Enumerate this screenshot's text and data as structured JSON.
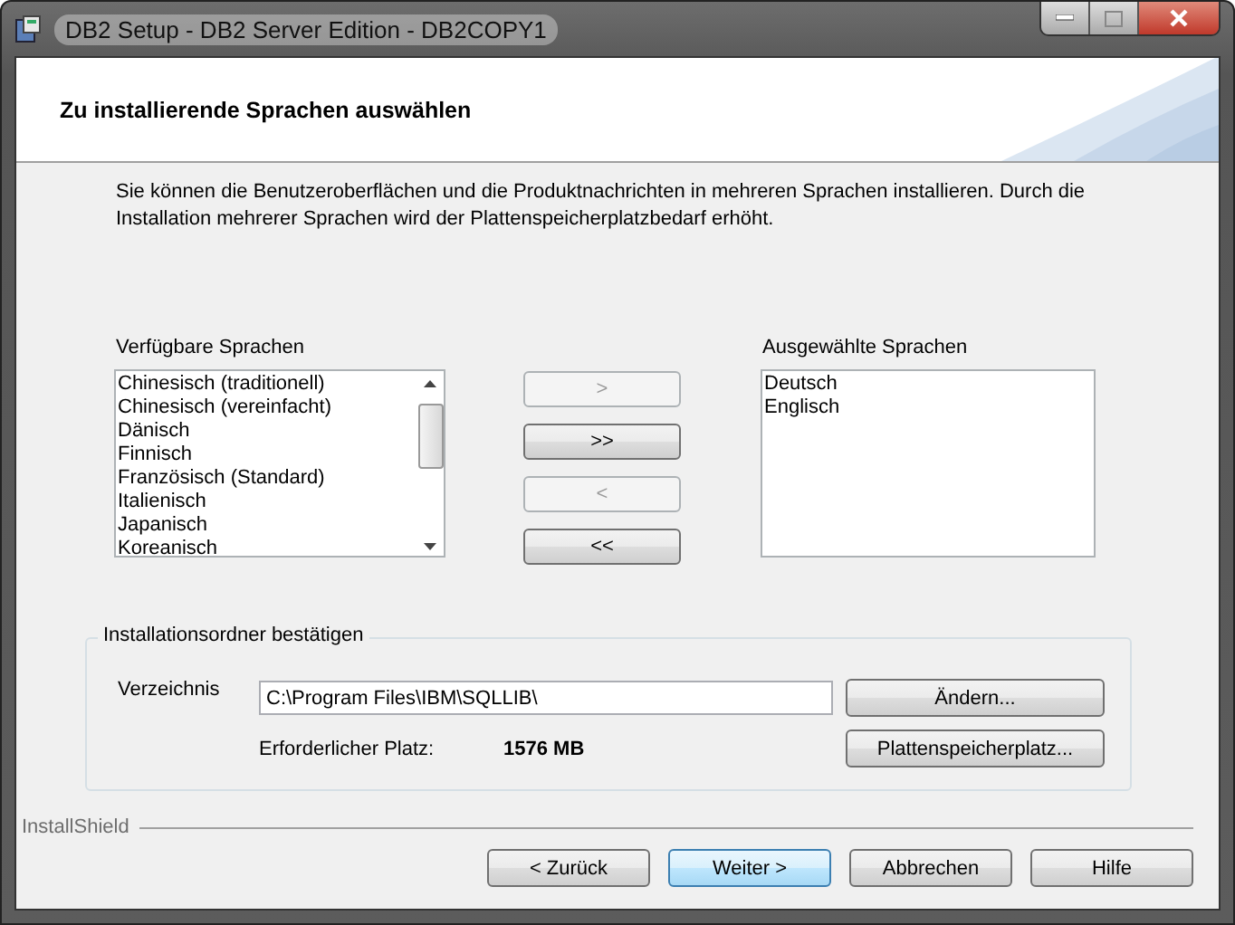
{
  "window": {
    "title": "DB2 Setup - DB2 Server Edition - DB2COPY1"
  },
  "header": {
    "title": "Zu installierende Sprachen auswählen"
  },
  "description": "Sie können die Benutzeroberflächen und die Produktnachrichten in mehreren Sprachen installieren. Durch die Installation mehrerer Sprachen wird der Plattenspeicherplatzbedarf erhöht.",
  "available": {
    "label": "Verfügbare Sprachen",
    "items": [
      "Chinesisch (traditionell)",
      "Chinesisch (vereinfacht)",
      "Dänisch",
      "Finnisch",
      "Französisch (Standard)",
      "Italienisch",
      "Japanisch",
      "Koreanisch"
    ]
  },
  "move_buttons": [
    {
      "label": ">",
      "disabled": true
    },
    {
      "label": ">>",
      "disabled": false
    },
    {
      "label": "<",
      "disabled": true
    },
    {
      "label": "<<",
      "disabled": false
    }
  ],
  "selected": {
    "label": "Ausgewählte Sprachen",
    "items": [
      "Deutsch",
      "Englisch"
    ]
  },
  "folder_group": {
    "title": "Installationsordner bestätigen",
    "directory_label": "Verzeichnis",
    "directory_value": "C:\\Program Files\\IBM\\SQLLIB\\",
    "change_button": "Ändern...",
    "space_label": "Erforderlicher Platz:",
    "space_value": "1576 MB",
    "space_button": "Plattenspeicherplatz..."
  },
  "footer": {
    "brand": "InstallShield",
    "buttons": [
      {
        "label": "< Zurück",
        "default": false
      },
      {
        "label": "Weiter >",
        "default": true
      },
      {
        "label": "Abbrechen",
        "default": false
      },
      {
        "label": "Hilfe",
        "default": false
      }
    ]
  }
}
